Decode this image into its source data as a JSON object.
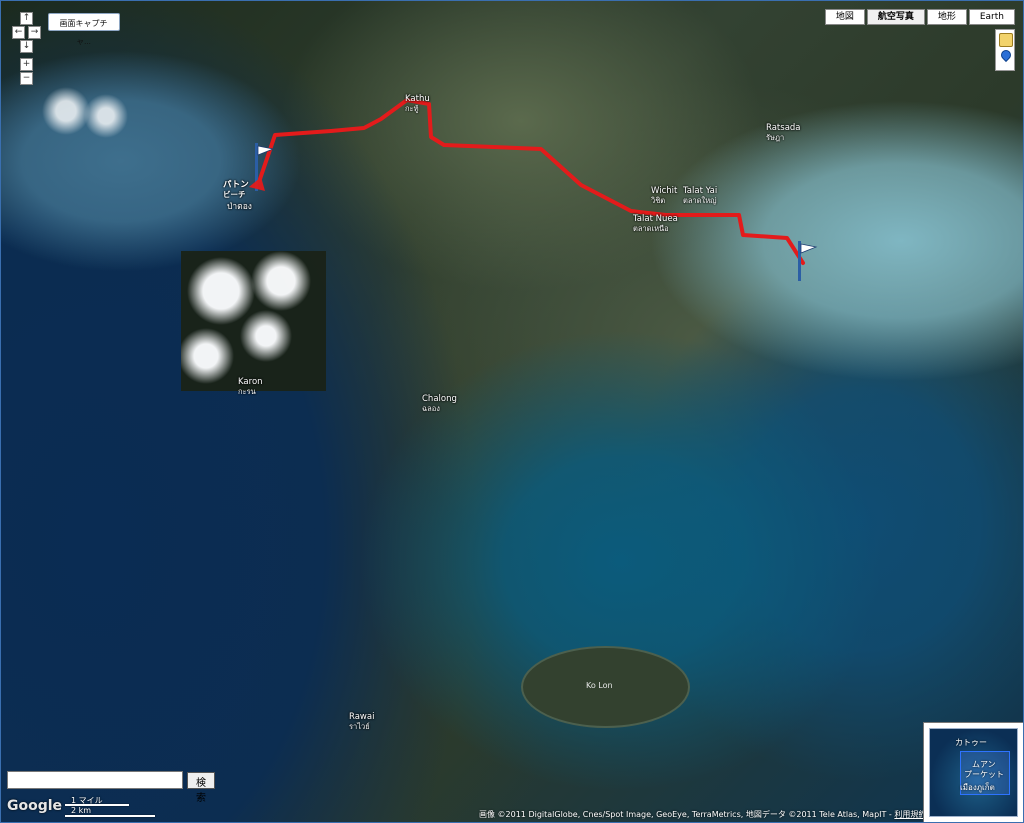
{
  "map": {
    "type_buttons": [
      {
        "label": "地図",
        "active": false
      },
      {
        "label": "航空写真",
        "active": true
      },
      {
        "label": "地形",
        "active": false
      },
      {
        "label": "Earth",
        "active": false
      }
    ],
    "nav_controls": {
      "up": "↑",
      "left": "←",
      "right": "→",
      "down": "↓",
      "zoom_in": "+",
      "zoom_out": "−"
    },
    "capture_button_label": "画面キャプチャ...",
    "search": {
      "placeholder": "",
      "button_label": "検索"
    },
    "logo_text": "Google",
    "scale": {
      "top": "1 マイル",
      "bottom": "2 km"
    },
    "attribution": {
      "text": "画像 ©2011 DigitalGlobe, Cnes/Spot Image, GeoEye, TerraMetrics, 地図データ ©2011 Tele Atlas, MapIT - ",
      "link": "利用規約"
    },
    "places": [
      {
        "id": "kathu",
        "name": "Kathu",
        "sub": "กะทู้"
      },
      {
        "id": "patong",
        "name": "パトン",
        "sub": "ビーチ"
      },
      {
        "id": "patong_th",
        "name": "ป่าตอง",
        "sub": ""
      },
      {
        "id": "wichit",
        "name": "Wichit",
        "sub": "วิชิต"
      },
      {
        "id": "talat_yai",
        "name": "Talat Yai",
        "sub": "ตลาดใหญ่"
      },
      {
        "id": "talat_nuea",
        "name": "Talat Nuea",
        "sub": "ตลาดเหนือ"
      },
      {
        "id": "ratsada",
        "name": "Ratsada",
        "sub": "รัษฎา"
      },
      {
        "id": "karon",
        "name": "Karon",
        "sub": "กะรน"
      },
      {
        "id": "chalong",
        "name": "Chalong",
        "sub": "ฉลอง"
      },
      {
        "id": "rawai",
        "name": "Rawai",
        "sub": "ราไวย์"
      },
      {
        "id": "ko_lon",
        "name": "Ko Lon",
        "sub": ""
      }
    ],
    "overview": {
      "label_top": "カトゥー",
      "label_mid": "ムアン",
      "label_bottom": "プーケット",
      "label_thai": "เมืองภูเก็ต"
    },
    "colors": {
      "route": "#e31b1b",
      "marker": "#e31b1b",
      "frame": "#3a6fb0"
    },
    "icons": {
      "start_marker": "flag-icon",
      "end_marker": "flag-icon",
      "pegman": "pegman-icon"
    }
  }
}
